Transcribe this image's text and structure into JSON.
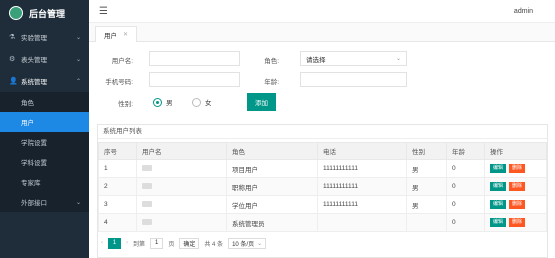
{
  "app": {
    "title": "后台管理"
  },
  "sidebar": {
    "menus": [
      {
        "label": "实验管理",
        "icon": "flask-icon"
      },
      {
        "label": "表头管理",
        "icon": "settings-icon"
      },
      {
        "label": "系统管理",
        "icon": "users-icon"
      }
    ],
    "submenu": [
      {
        "label": "角色"
      },
      {
        "label": "用户"
      },
      {
        "label": "学院设置"
      },
      {
        "label": "学科设置"
      },
      {
        "label": "专家库"
      },
      {
        "label": "外部接口"
      }
    ]
  },
  "topbar": {
    "user": "admin"
  },
  "tab": {
    "label": "用户"
  },
  "form": {
    "username_label": "用户名:",
    "role_label": "角色:",
    "role_select": "请选择",
    "phone_label": "手机号码:",
    "age_label": "年龄:",
    "gender_label": "性别:",
    "male": "男",
    "female": "女",
    "add_button": "添加"
  },
  "table": {
    "title": "系统用户列表",
    "headers": [
      "序号",
      "用户名",
      "角色",
      "电话",
      "性别",
      "年龄",
      "操作"
    ],
    "rows": [
      {
        "no": "1",
        "role": "项目用户",
        "phone": "11111111111",
        "gender": "男",
        "age": "0"
      },
      {
        "no": "2",
        "role": "职称用户",
        "phone": "11111111111",
        "gender": "男",
        "age": "0"
      },
      {
        "no": "3",
        "role": "学位用户",
        "phone": "11111111111",
        "gender": "男",
        "age": "0"
      },
      {
        "no": "4",
        "role": "系统管理员",
        "phone": "",
        "gender": "",
        "age": "0"
      }
    ],
    "edit_label": "编辑",
    "delete_label": "删除"
  },
  "pager": {
    "current": "1",
    "goto_label": "到第",
    "page_input": "1",
    "page_unit": "页",
    "confirm": "确定",
    "total": "共 4 条",
    "page_size": "10 条/页"
  }
}
